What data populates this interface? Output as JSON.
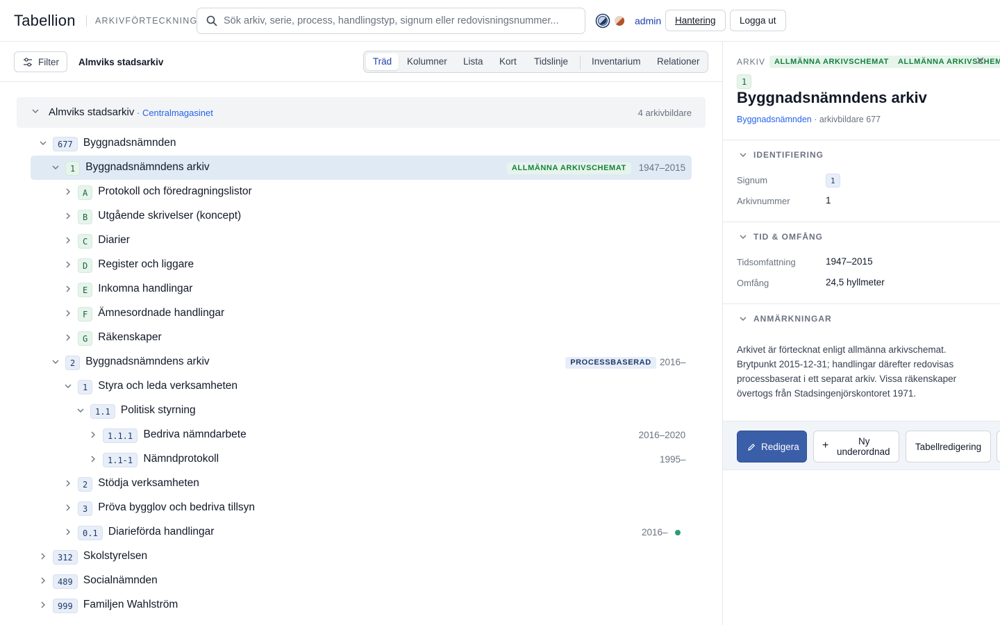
{
  "header": {
    "logo": "Tabellion",
    "subtitle": "ARKIVFÖRTECKNING",
    "search_placeholder": "Sök arkiv, serie, process, handlingstyp, signum eller redovisningsnummer...",
    "user": "admin",
    "manage_label": "Hantering",
    "logout_label": "Logga ut"
  },
  "toolbar": {
    "filter_label": "Filter",
    "breadcrumb": "Almviks stadsarkiv",
    "views": [
      "Träd",
      "Kolumner",
      "Lista",
      "Kort",
      "Tidslinje",
      "Inventarium",
      "Relationer"
    ],
    "active_view": "Träd"
  },
  "tree": {
    "repository": {
      "name": "Almviks stadsarkiv",
      "location": "· Centralmagasinet",
      "count": "4 arkivbildare"
    },
    "rows": [
      {
        "code": "677",
        "label": "Byggnadsnämnden",
        "badge": "blue",
        "expanded": true,
        "tag": "",
        "years": ""
      },
      {
        "code": "1",
        "label": "Byggnadsnämndens arkiv",
        "badge": "green",
        "expanded": true,
        "selected": true,
        "tag": "ALLMÄNNA ARKIVSCHEMAT",
        "years": "1947–2015"
      },
      {
        "code": "A",
        "label": "Protokoll och föredragningslistor",
        "badge": "green",
        "tag": "",
        "years": ""
      },
      {
        "code": "B",
        "label": "Utgående skrivelser (koncept)",
        "badge": "green",
        "tag": "",
        "years": ""
      },
      {
        "code": "C",
        "label": "Diarier",
        "badge": "green",
        "tag": "",
        "years": ""
      },
      {
        "code": "D",
        "label": "Register och liggare",
        "badge": "green",
        "tag": "",
        "years": ""
      },
      {
        "code": "E",
        "label": "Inkomna handlingar",
        "badge": "green",
        "tag": "",
        "years": ""
      },
      {
        "code": "F",
        "label": "Ämnesordnade handlingar",
        "badge": "green",
        "tag": "",
        "years": ""
      },
      {
        "code": "G",
        "label": "Räkenskaper",
        "badge": "green",
        "tag": "",
        "years": ""
      },
      {
        "code": "2",
        "label": "Byggnadsnämndens arkiv",
        "badge": "blue",
        "expanded": true,
        "tag": "PROCESSBASERAD",
        "years": "2016–"
      },
      {
        "code": "1",
        "label": "Styra och leda verksamheten",
        "badge": "blue",
        "expanded": true,
        "tag": "",
        "years": ""
      },
      {
        "code": "1.1",
        "label": "Politisk styrning",
        "badge": "blue",
        "expanded": true,
        "tag": "",
        "years": ""
      },
      {
        "code": "1.1.1",
        "label": "Bedriva nämndarbete",
        "badge": "blue",
        "tag": "",
        "years": "2016–2020"
      },
      {
        "code": "1.1-1",
        "label": "Nämndprotokoll",
        "badge": "blue",
        "tag": "",
        "years": "1995–"
      },
      {
        "code": "2",
        "label": "Stödja verksamheten",
        "badge": "blue",
        "tag": "",
        "years": ""
      },
      {
        "code": "3",
        "label": "Pröva bygglov och bedriva tillsyn",
        "badge": "blue",
        "tag": "",
        "years": ""
      },
      {
        "code": "0.1",
        "label": "Diarieförda handlingar",
        "badge": "blue",
        "tag": "",
        "years": "2016–",
        "dot": true
      },
      {
        "code": "312",
        "label": "Skolstyrelsen",
        "badge": "blue",
        "tag": "",
        "years": ""
      },
      {
        "code": "489",
        "label": "Socialnämnden",
        "badge": "blue",
        "tag": "",
        "years": ""
      },
      {
        "code": "999",
        "label": "Familjen Wahlström",
        "badge": "blue",
        "tag": "",
        "years": ""
      }
    ]
  },
  "detail": {
    "kind": "ARKIV",
    "tags": [
      "ALLMÄNNA ARKIVSCHEMAT",
      "ALLMÄNNA ARKIVSCHEMAT"
    ],
    "number": "1",
    "title": "Byggnadsnämndens arkiv",
    "parent_link": "Byggnadsnämnden",
    "parent_suffix": " · arkivbildare 677",
    "sections": {
      "identification": {
        "heading": "IDENTIFIERING",
        "signum_label": "Signum",
        "signum_value": "1",
        "archive_number_label": "Arkivnummer",
        "archive_number_value": "1"
      },
      "time": {
        "heading": "TID & OMFÅNG",
        "time_label": "Tidsomfattning",
        "time_value": "1947–2015",
        "extent_label": "Omfång",
        "extent_value": "24,5 hyllmeter"
      },
      "notes": {
        "heading": "ANMÄRKNINGAR",
        "text": "Arkivet är förtecknat enligt allmänna arkivschemat. Brytpunkt 2015-12-31; handlingar därefter redovisas processbaserat i ett separat arkiv. Vissa räkenskaper övertogs från Stadsingenjörskontoret 1971."
      }
    },
    "actions": {
      "edit": "Redigera",
      "new_child_line1": "Ny",
      "new_child_line2": "underordnad",
      "table_edit": "Tabellredigering"
    }
  },
  "colors": {
    "accent": "#3b5ea8",
    "link": "#2563eb",
    "green_tag": "#15803d",
    "selected_row": "#e0eaf5"
  }
}
